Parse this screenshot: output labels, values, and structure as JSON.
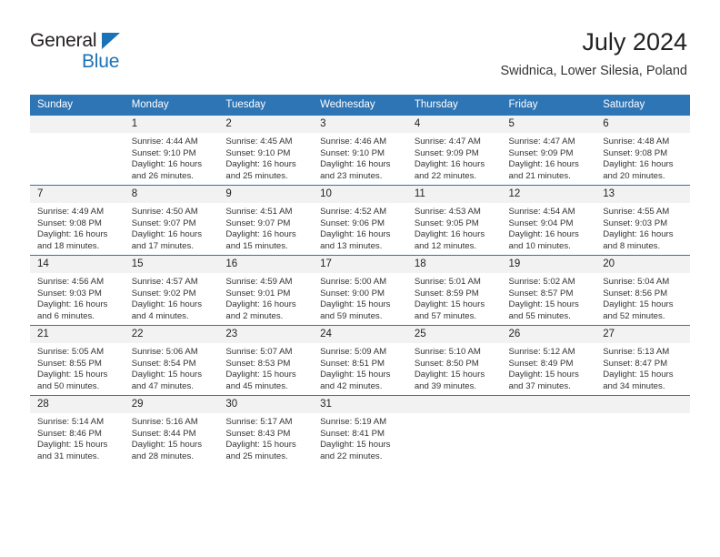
{
  "brand": {
    "name_dark": "General",
    "name_light": "Blue",
    "triangle_color": "#1a72b8"
  },
  "header": {
    "month_title": "July 2024",
    "location": "Swidnica, Lower Silesia, Poland",
    "header_bg": "#2e75b6"
  },
  "weekday_headers": [
    "Sunday",
    "Monday",
    "Tuesday",
    "Wednesday",
    "Thursday",
    "Friday",
    "Saturday"
  ],
  "labels": {
    "sunrise_prefix": "Sunrise:",
    "sunset_prefix": "Sunset:",
    "daylight_prefix": "Daylight:"
  },
  "weeks": [
    [
      {
        "day": "",
        "sunrise": "",
        "sunset": "",
        "daylight_line1": "",
        "daylight_line2": ""
      },
      {
        "day": "1",
        "sunrise": "Sunrise: 4:44 AM",
        "sunset": "Sunset: 9:10 PM",
        "daylight_line1": "Daylight: 16 hours",
        "daylight_line2": "and 26 minutes."
      },
      {
        "day": "2",
        "sunrise": "Sunrise: 4:45 AM",
        "sunset": "Sunset: 9:10 PM",
        "daylight_line1": "Daylight: 16 hours",
        "daylight_line2": "and 25 minutes."
      },
      {
        "day": "3",
        "sunrise": "Sunrise: 4:46 AM",
        "sunset": "Sunset: 9:10 PM",
        "daylight_line1": "Daylight: 16 hours",
        "daylight_line2": "and 23 minutes."
      },
      {
        "day": "4",
        "sunrise": "Sunrise: 4:47 AM",
        "sunset": "Sunset: 9:09 PM",
        "daylight_line1": "Daylight: 16 hours",
        "daylight_line2": "and 22 minutes."
      },
      {
        "day": "5",
        "sunrise": "Sunrise: 4:47 AM",
        "sunset": "Sunset: 9:09 PM",
        "daylight_line1": "Daylight: 16 hours",
        "daylight_line2": "and 21 minutes."
      },
      {
        "day": "6",
        "sunrise": "Sunrise: 4:48 AM",
        "sunset": "Sunset: 9:08 PM",
        "daylight_line1": "Daylight: 16 hours",
        "daylight_line2": "and 20 minutes."
      }
    ],
    [
      {
        "day": "7",
        "sunrise": "Sunrise: 4:49 AM",
        "sunset": "Sunset: 9:08 PM",
        "daylight_line1": "Daylight: 16 hours",
        "daylight_line2": "and 18 minutes."
      },
      {
        "day": "8",
        "sunrise": "Sunrise: 4:50 AM",
        "sunset": "Sunset: 9:07 PM",
        "daylight_line1": "Daylight: 16 hours",
        "daylight_line2": "and 17 minutes."
      },
      {
        "day": "9",
        "sunrise": "Sunrise: 4:51 AM",
        "sunset": "Sunset: 9:07 PM",
        "daylight_line1": "Daylight: 16 hours",
        "daylight_line2": "and 15 minutes."
      },
      {
        "day": "10",
        "sunrise": "Sunrise: 4:52 AM",
        "sunset": "Sunset: 9:06 PM",
        "daylight_line1": "Daylight: 16 hours",
        "daylight_line2": "and 13 minutes."
      },
      {
        "day": "11",
        "sunrise": "Sunrise: 4:53 AM",
        "sunset": "Sunset: 9:05 PM",
        "daylight_line1": "Daylight: 16 hours",
        "daylight_line2": "and 12 minutes."
      },
      {
        "day": "12",
        "sunrise": "Sunrise: 4:54 AM",
        "sunset": "Sunset: 9:04 PM",
        "daylight_line1": "Daylight: 16 hours",
        "daylight_line2": "and 10 minutes."
      },
      {
        "day": "13",
        "sunrise": "Sunrise: 4:55 AM",
        "sunset": "Sunset: 9:03 PM",
        "daylight_line1": "Daylight: 16 hours",
        "daylight_line2": "and 8 minutes."
      }
    ],
    [
      {
        "day": "14",
        "sunrise": "Sunrise: 4:56 AM",
        "sunset": "Sunset: 9:03 PM",
        "daylight_line1": "Daylight: 16 hours",
        "daylight_line2": "and 6 minutes."
      },
      {
        "day": "15",
        "sunrise": "Sunrise: 4:57 AM",
        "sunset": "Sunset: 9:02 PM",
        "daylight_line1": "Daylight: 16 hours",
        "daylight_line2": "and 4 minutes."
      },
      {
        "day": "16",
        "sunrise": "Sunrise: 4:59 AM",
        "sunset": "Sunset: 9:01 PM",
        "daylight_line1": "Daylight: 16 hours",
        "daylight_line2": "and 2 minutes."
      },
      {
        "day": "17",
        "sunrise": "Sunrise: 5:00 AM",
        "sunset": "Sunset: 9:00 PM",
        "daylight_line1": "Daylight: 15 hours",
        "daylight_line2": "and 59 minutes."
      },
      {
        "day": "18",
        "sunrise": "Sunrise: 5:01 AM",
        "sunset": "Sunset: 8:59 PM",
        "daylight_line1": "Daylight: 15 hours",
        "daylight_line2": "and 57 minutes."
      },
      {
        "day": "19",
        "sunrise": "Sunrise: 5:02 AM",
        "sunset": "Sunset: 8:57 PM",
        "daylight_line1": "Daylight: 15 hours",
        "daylight_line2": "and 55 minutes."
      },
      {
        "day": "20",
        "sunrise": "Sunrise: 5:04 AM",
        "sunset": "Sunset: 8:56 PM",
        "daylight_line1": "Daylight: 15 hours",
        "daylight_line2": "and 52 minutes."
      }
    ],
    [
      {
        "day": "21",
        "sunrise": "Sunrise: 5:05 AM",
        "sunset": "Sunset: 8:55 PM",
        "daylight_line1": "Daylight: 15 hours",
        "daylight_line2": "and 50 minutes."
      },
      {
        "day": "22",
        "sunrise": "Sunrise: 5:06 AM",
        "sunset": "Sunset: 8:54 PM",
        "daylight_line1": "Daylight: 15 hours",
        "daylight_line2": "and 47 minutes."
      },
      {
        "day": "23",
        "sunrise": "Sunrise: 5:07 AM",
        "sunset": "Sunset: 8:53 PM",
        "daylight_line1": "Daylight: 15 hours",
        "daylight_line2": "and 45 minutes."
      },
      {
        "day": "24",
        "sunrise": "Sunrise: 5:09 AM",
        "sunset": "Sunset: 8:51 PM",
        "daylight_line1": "Daylight: 15 hours",
        "daylight_line2": "and 42 minutes."
      },
      {
        "day": "25",
        "sunrise": "Sunrise: 5:10 AM",
        "sunset": "Sunset: 8:50 PM",
        "daylight_line1": "Daylight: 15 hours",
        "daylight_line2": "and 39 minutes."
      },
      {
        "day": "26",
        "sunrise": "Sunrise: 5:12 AM",
        "sunset": "Sunset: 8:49 PM",
        "daylight_line1": "Daylight: 15 hours",
        "daylight_line2": "and 37 minutes."
      },
      {
        "day": "27",
        "sunrise": "Sunrise: 5:13 AM",
        "sunset": "Sunset: 8:47 PM",
        "daylight_line1": "Daylight: 15 hours",
        "daylight_line2": "and 34 minutes."
      }
    ],
    [
      {
        "day": "28",
        "sunrise": "Sunrise: 5:14 AM",
        "sunset": "Sunset: 8:46 PM",
        "daylight_line1": "Daylight: 15 hours",
        "daylight_line2": "and 31 minutes."
      },
      {
        "day": "29",
        "sunrise": "Sunrise: 5:16 AM",
        "sunset": "Sunset: 8:44 PM",
        "daylight_line1": "Daylight: 15 hours",
        "daylight_line2": "and 28 minutes."
      },
      {
        "day": "30",
        "sunrise": "Sunrise: 5:17 AM",
        "sunset": "Sunset: 8:43 PM",
        "daylight_line1": "Daylight: 15 hours",
        "daylight_line2": "and 25 minutes."
      },
      {
        "day": "31",
        "sunrise": "Sunrise: 5:19 AM",
        "sunset": "Sunset: 8:41 PM",
        "daylight_line1": "Daylight: 15 hours",
        "daylight_line2": "and 22 minutes."
      },
      {
        "day": "",
        "sunrise": "",
        "sunset": "",
        "daylight_line1": "",
        "daylight_line2": ""
      },
      {
        "day": "",
        "sunrise": "",
        "sunset": "",
        "daylight_line1": "",
        "daylight_line2": ""
      },
      {
        "day": "",
        "sunrise": "",
        "sunset": "",
        "daylight_line1": "",
        "daylight_line2": ""
      }
    ]
  ]
}
